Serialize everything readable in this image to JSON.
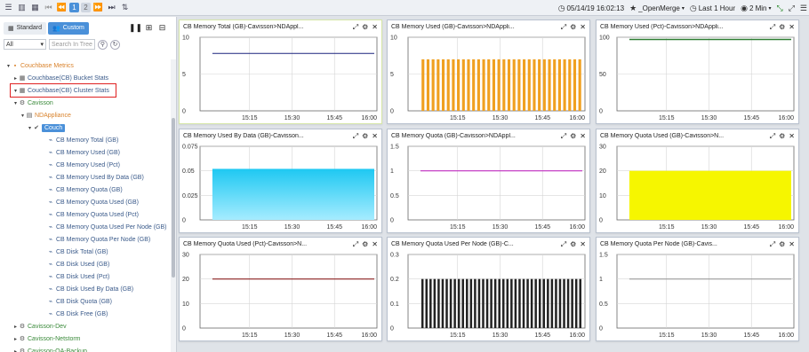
{
  "topbar": {
    "page_numbers": [
      "1",
      "2"
    ],
    "datetime": "05/14/19 16:02:13",
    "merge_label": "_OpenMerge",
    "range_label": "Last 1 Hour",
    "refresh_label": "2 Min"
  },
  "sidebar": {
    "tab_standard": "Standard",
    "tab_custom": "Custom",
    "filter_value": "All",
    "search_placeholder": "Search In Tree",
    "tree": [
      {
        "label": "Couchbase Metrics",
        "level": 0,
        "style": "orange",
        "caret": "▾",
        "icon": "folder"
      },
      {
        "label": "Couchbase(CB) Bucket Stats",
        "level": 1,
        "style": "blue",
        "caret": "▸",
        "icon": "grid"
      },
      {
        "label": "Couchbase(CB) Cluster Stats",
        "level": 1,
        "style": "blue",
        "caret": "▾",
        "icon": "grid",
        "selected": true
      },
      {
        "label": "Cavisson",
        "level": 2,
        "style": "green",
        "caret": "▾",
        "icon": "gears"
      },
      {
        "label": "NDAppliance",
        "level": 3,
        "style": "orange",
        "caret": "▾",
        "icon": "server"
      },
      {
        "label": "Couch",
        "level": 4,
        "style": "pill",
        "caret": "▾",
        "icon": "check"
      },
      {
        "label": "CB Memory Total (GB)",
        "level": 5,
        "style": "blue",
        "caret": "",
        "icon": "chart"
      },
      {
        "label": "CB Memory Used (GB)",
        "level": 5,
        "style": "blue",
        "caret": "",
        "icon": "chart"
      },
      {
        "label": "CB Memory Used (Pct)",
        "level": 5,
        "style": "blue",
        "caret": "",
        "icon": "chart"
      },
      {
        "label": "CB Memory Used By Data (GB)",
        "level": 5,
        "style": "blue",
        "caret": "",
        "icon": "chart"
      },
      {
        "label": "CB Memory Quota (GB)",
        "level": 5,
        "style": "blue",
        "caret": "",
        "icon": "chart"
      },
      {
        "label": "CB Memory Quota Used (GB)",
        "level": 5,
        "style": "blue",
        "caret": "",
        "icon": "chart"
      },
      {
        "label": "CB Memory Quota Used (Pct)",
        "level": 5,
        "style": "blue",
        "caret": "",
        "icon": "chart"
      },
      {
        "label": "CB Memory Quota Used Per Node (GB)",
        "level": 5,
        "style": "blue",
        "caret": "",
        "icon": "chart"
      },
      {
        "label": "CB Memory Quota Per Node (GB)",
        "level": 5,
        "style": "blue",
        "caret": "",
        "icon": "chart"
      },
      {
        "label": "CB Disk Total (GB)",
        "level": 5,
        "style": "blue",
        "caret": "",
        "icon": "chart"
      },
      {
        "label": "CB Disk Used (GB)",
        "level": 5,
        "style": "blue",
        "caret": "",
        "icon": "chart"
      },
      {
        "label": "CB Disk Used (Pct)",
        "level": 5,
        "style": "blue",
        "caret": "",
        "icon": "chart"
      },
      {
        "label": "CB Disk Used By Data (GB)",
        "level": 5,
        "style": "blue",
        "caret": "",
        "icon": "chart"
      },
      {
        "label": "CB Disk Quota (GB)",
        "level": 5,
        "style": "blue",
        "caret": "",
        "icon": "chart"
      },
      {
        "label": "CB Disk Free (GB)",
        "level": 5,
        "style": "blue",
        "caret": "",
        "icon": "chart"
      },
      {
        "label": "Cavisson-Dev",
        "level": 2,
        "style": "green",
        "caret": "▸",
        "icon": "gears"
      },
      {
        "label": "Cavisson-Netstorm",
        "level": 2,
        "style": "green",
        "caret": "▸",
        "icon": "gears"
      },
      {
        "label": "Cavisson-QA-Backup",
        "level": 2,
        "style": "green",
        "caret": "▸",
        "icon": "gears"
      }
    ]
  },
  "colors": {
    "navy": "#1a237e",
    "orange": "#f0a020",
    "green": "#2e7d32",
    "cyan": "#29c6f0",
    "magenta": "#c02cc0",
    "yellow": "#f6f600",
    "brown": "#8b2020",
    "black": "#222222",
    "gray": "#9a9a9a",
    "accent": "#4a90d9"
  },
  "chart_data": [
    {
      "title": "CB Memory Total (GB)-Cavisson>NDAppl...",
      "type": "line",
      "color": "navy",
      "x": [
        "15:15",
        "15:30",
        "15:45",
        "16:00"
      ],
      "yticks": [
        "0",
        "5",
        "10"
      ],
      "ylim": [
        0,
        10
      ],
      "value": 7.8
    },
    {
      "title": "CB Memory Used (GB)-Cavisson>NDAppli...",
      "type": "bar",
      "color": "orange",
      "x": [
        "15:15",
        "15:30",
        "15:45",
        "16:00"
      ],
      "yticks": [
        "0",
        "5",
        "10"
      ],
      "ylim": [
        0,
        10
      ],
      "value": 7,
      "bars": 32
    },
    {
      "title": "CB Memory Used (Pct)-Cavisson>NDAppli...",
      "type": "line",
      "color": "green",
      "x": [
        "15:15",
        "15:30",
        "15:45",
        "16:00"
      ],
      "yticks": [
        "0",
        "50",
        "100"
      ],
      "ylim": [
        0,
        100
      ],
      "value": 97
    },
    {
      "title": "CB Memory Used By Data (GB)-Cavisson...",
      "type": "area",
      "color": "cyan",
      "x": [
        "15:15",
        "15:30",
        "15:45",
        "16:00"
      ],
      "yticks": [
        "0",
        "0.025",
        "0.05",
        "0.075"
      ],
      "ylim": [
        0,
        0.075
      ],
      "value": 0.052
    },
    {
      "title": "CB Memory Quota (GB)-Cavisson>NDAppl...",
      "type": "line",
      "color": "magenta",
      "x": [
        "15:15",
        "15:30",
        "15:45",
        "16:00"
      ],
      "yticks": [
        "0",
        "0.5",
        "1",
        "1.5"
      ],
      "ylim": [
        0,
        1.5
      ],
      "value": 1
    },
    {
      "title": "CB Memory Quota Used (GB)-Cavisson>N...",
      "type": "area",
      "color": "yellow",
      "x": [
        "15:15",
        "15:30",
        "15:45",
        "16:00"
      ],
      "yticks": [
        "0",
        "10",
        "20",
        "30"
      ],
      "ylim": [
        0,
        30
      ],
      "value": 20
    },
    {
      "title": "CB Memory Quota Used (Pct)-Cavisson>N...",
      "type": "line",
      "color": "brown",
      "x": [
        "15:15",
        "15:30",
        "15:45",
        "16:00"
      ],
      "yticks": [
        "0",
        "10",
        "20",
        "30"
      ],
      "ylim": [
        0,
        30
      ],
      "value": 20
    },
    {
      "title": "CB Memory Quota Used Per Node (GB)-C...",
      "type": "bar",
      "color": "black",
      "x": [
        "15:15",
        "15:30",
        "15:45",
        "16:00"
      ],
      "yticks": [
        "0",
        "0.1",
        "0.2",
        "0.3"
      ],
      "ylim": [
        0,
        0.3
      ],
      "value": 0.2,
      "bars": 40
    },
    {
      "title": "CB Memory Quota Per Node (GB)-Cavis...",
      "type": "line",
      "color": "gray",
      "x": [
        "15:15",
        "15:30",
        "15:45",
        "16:00"
      ],
      "yticks": [
        "0",
        "0.5",
        "1",
        "1.5"
      ],
      "ylim": [
        0,
        1.5
      ],
      "value": 1
    }
  ]
}
